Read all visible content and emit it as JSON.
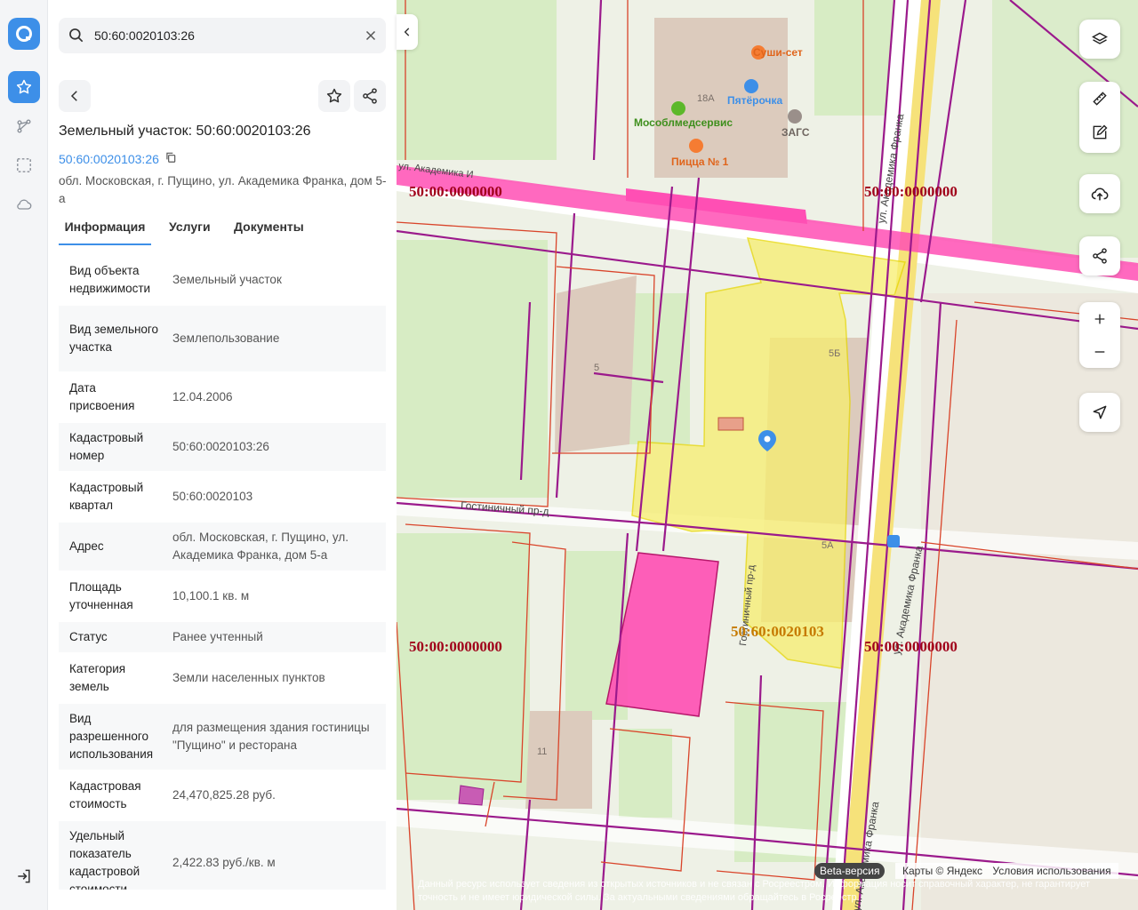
{
  "search": {
    "value": "50:60:0020103:26"
  },
  "object": {
    "title": "Земельный участок: 50:60:0020103:26",
    "cad_link": "50:60:0020103:26",
    "address": "обл. Московская, г. Пущино, ул. Академика Франка, дом 5-а"
  },
  "tabs": [
    {
      "label": "Информация"
    },
    {
      "label": "Услуги"
    },
    {
      "label": "Документы"
    }
  ],
  "info": [
    {
      "key": "Вид объекта недвижимости",
      "value": "Земельный участок"
    },
    {
      "key": "Вид земельного участка",
      "value": "Землепользование"
    },
    {
      "key": "Дата присвоения",
      "value": "12.04.2006"
    },
    {
      "key": "Кадастровый номер",
      "value": "50:60:0020103:26"
    },
    {
      "key": "Кадастровый квартал",
      "value": "50:60:0020103"
    },
    {
      "key": "Адрес",
      "value": "обл. Московская, г. Пущино, ул. Академика Франка, дом 5-а"
    },
    {
      "key": "Площадь уточненная",
      "value": "10,100.1 кв. м"
    },
    {
      "key": "Статус",
      "value": "Ранее учтенный"
    },
    {
      "key": "Категория земель",
      "value": "Земли населенных пунктов"
    },
    {
      "key": "Вид разрешенного использования",
      "value": "для размещения здания гостиницы \"Пущино\" и ресторана"
    },
    {
      "key": "Кадастровая стоимость",
      "value": "24,470,825.28 руб."
    },
    {
      "key": "Удельный показатель кадастровой стоимости",
      "value": "2,422.83 руб./кв. м"
    }
  ],
  "map": {
    "pois": {
      "sushi": "Суши-сет",
      "pyaterochka": "Пятёрочка",
      "mosoblmed": "Мособлмедсервис",
      "zags": "ЗАГС",
      "pizza": "Пицца № 1"
    },
    "buildings": {
      "b18a": "18А",
      "b5": "5",
      "b5b": "5Б",
      "b5a": "5А",
      "b11": "11"
    },
    "streets": {
      "frank": "ул. Академика Франка",
      "frank2": "ул. Академика Франка",
      "frank3": "ул. Академика Франка",
      "gost": "Гостиничный пр-д",
      "gost2": "Гостиничный пр-д",
      "akad": "ул. Академика И"
    },
    "cad_labels": {
      "l1": "50:00:0000000",
      "l2": "50:00:0000000",
      "l3": "50:00:0000000",
      "l4": "50:00:0000000",
      "l5": "50:60:0020103"
    },
    "beta": "Beta-версия",
    "yandex": "Карты © Яндекс",
    "terms": "Условия использования",
    "disclaimer": "Данный ресурс использует сведения из открытых источников и не связан с Росреестром. Информация носит справочный характер, не гарантирует точность и не имеет юридической силы. За актуальными сведениями обращайтесь в Росреестр."
  },
  "colors": {
    "accent": "#3d8fe8",
    "parcel": "#f7ee6e",
    "road": "#ff4fb4",
    "boundary": "#9b1a8c"
  }
}
